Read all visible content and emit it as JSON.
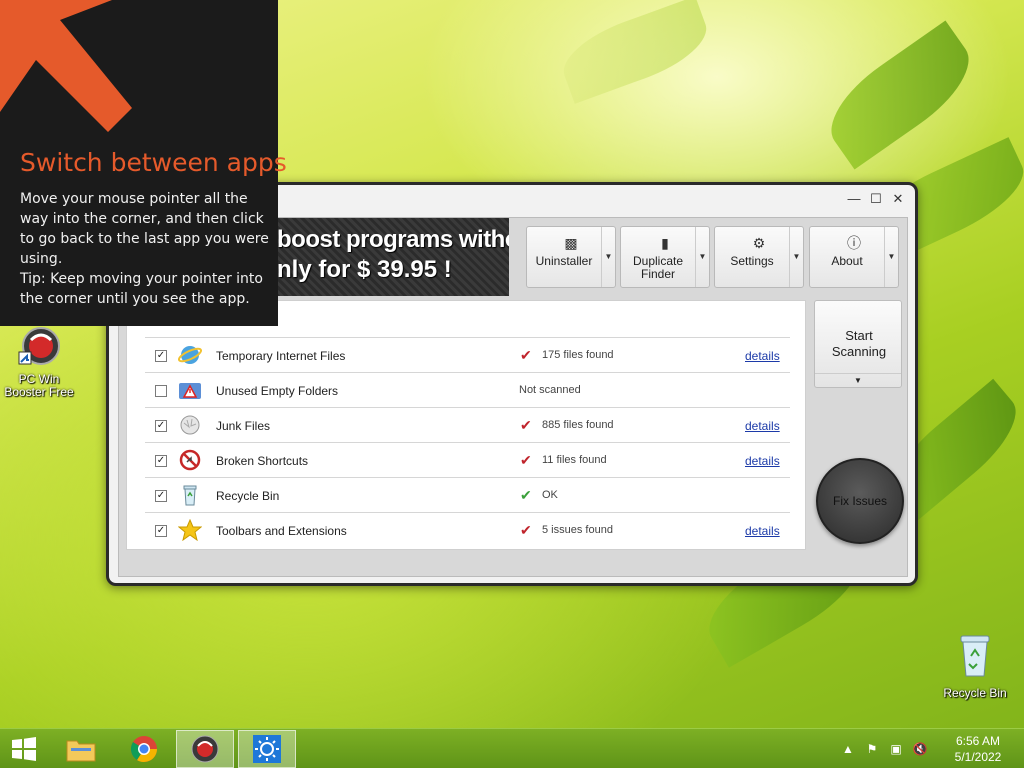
{
  "hint": {
    "title": "Switch between apps",
    "body": "Move your mouse pointer all the way into the corner, and then click to go back to the last app you were using.",
    "tip": "Tip: Keep moving your pointer into the corner until you see the app."
  },
  "desktop": {
    "pcwin_label": "PC Win Booster Free",
    "recycle_label": "Recycle Bin"
  },
  "app": {
    "banner_line1": "boost programs without",
    "banner_line2": "nly for $ 39.95 !",
    "toolbar": [
      {
        "label": "Uninstaller",
        "icon": "trash-icon"
      },
      {
        "label": "Duplicate Finder",
        "icon": "document-icon"
      },
      {
        "label": "Settings",
        "icon": "gears-icon"
      },
      {
        "label": "About",
        "icon": "info-icon"
      }
    ],
    "start_scanning": "Start Scanning",
    "fix_issues": "Fix Issues",
    "items": [
      {
        "checked": true,
        "name": "Temporary Internet Files",
        "status": "175 files found",
        "mark": "check-red",
        "details": "details"
      },
      {
        "checked": false,
        "name": "Unused Empty Folders",
        "status": "Not scanned",
        "mark": "",
        "details": ""
      },
      {
        "checked": true,
        "name": "Junk Files",
        "status": "885 files found",
        "mark": "check-red",
        "details": "details"
      },
      {
        "checked": true,
        "name": "Broken Shortcuts",
        "status": "11 files found",
        "mark": "check-red",
        "details": "details"
      },
      {
        "checked": true,
        "name": "Recycle Bin",
        "status": "OK",
        "mark": "check-green",
        "details": ""
      },
      {
        "checked": true,
        "name": "Toolbars and Extensions",
        "status": "5 issues found",
        "mark": "check-red",
        "details": "details"
      }
    ]
  },
  "taskbar": {
    "time": "6:56 AM",
    "date": "5/1/2022"
  },
  "colors": {
    "hint_title": "#e55a2b",
    "check_red": "#c0242c",
    "check_green": "#3aa03a",
    "link": "#1c3aa8"
  }
}
